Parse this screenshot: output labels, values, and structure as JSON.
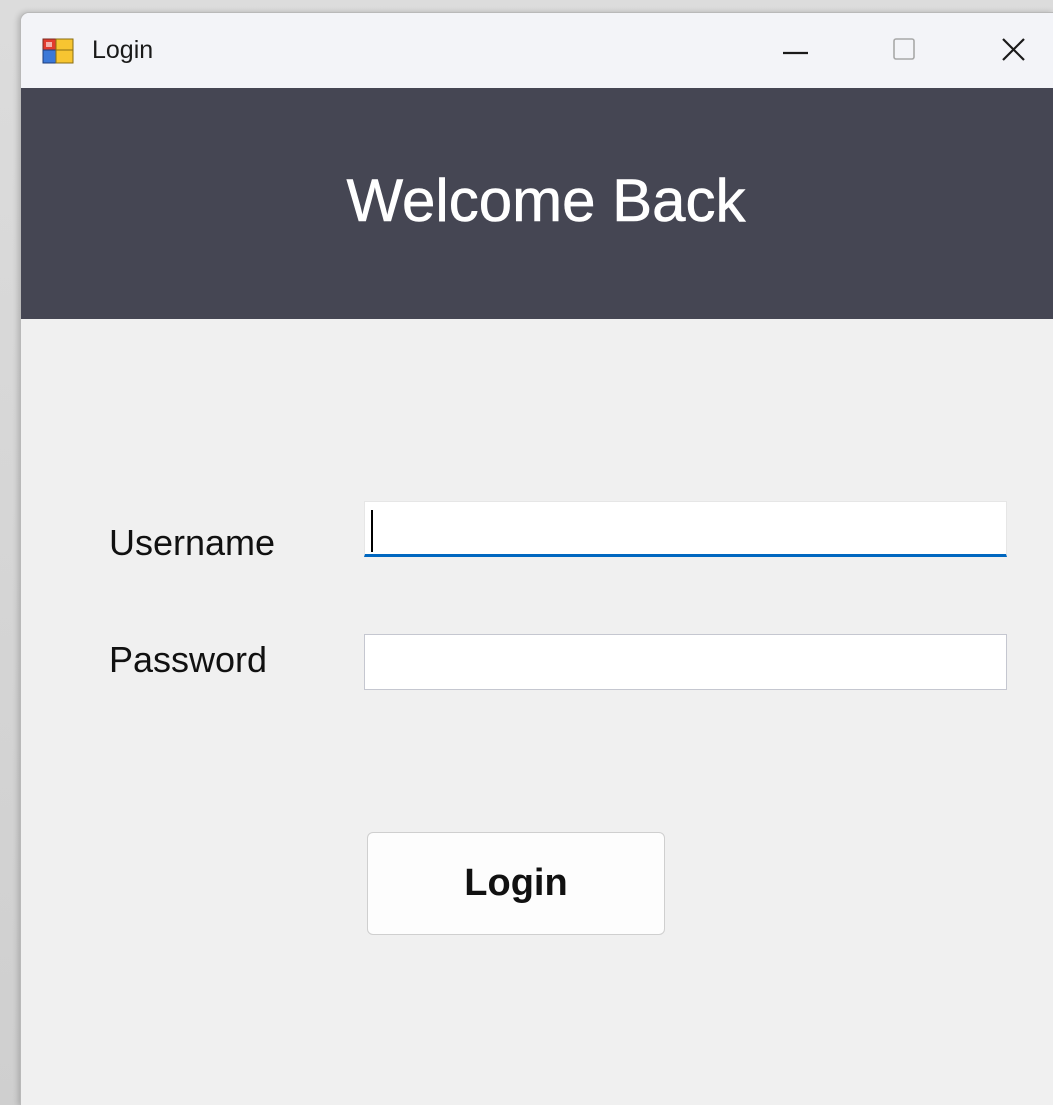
{
  "window": {
    "title": "Login",
    "app_icon": "winforms-app-icon",
    "controls": {
      "minimize_icon": "minimize-icon",
      "maximize_icon": "maximize-icon",
      "close_icon": "close-icon"
    }
  },
  "header": {
    "title": "Welcome Back",
    "background_color": "#454653",
    "text_color": "#ffffff"
  },
  "form": {
    "username_label": "Username",
    "username_value": "",
    "password_label": "Password",
    "password_value": "",
    "focus_accent_color": "#0067c0",
    "submit_label": "Login"
  }
}
